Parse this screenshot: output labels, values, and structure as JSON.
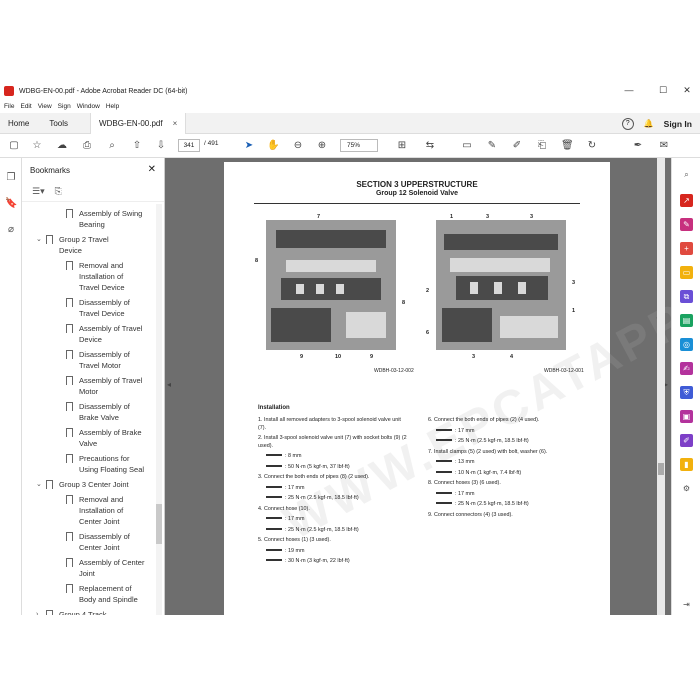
{
  "window": {
    "title": "WDBG-EN-00.pdf - Adobe Acrobat Reader DC (64-bit)",
    "minimize": "—",
    "maximize": "☐",
    "close": "✕"
  },
  "menu": [
    "File",
    "Edit",
    "View",
    "Sign",
    "Window",
    "Help"
  ],
  "tabs": {
    "home": "Home",
    "tools": "Tools",
    "document": "WDBG-EN-00.pdf",
    "close": "×"
  },
  "header_right": {
    "help": "?",
    "bell": "🔔",
    "sign_in": "Sign In"
  },
  "toolbar": {
    "page_current": "341",
    "page_separator": "/",
    "page_total": "491",
    "zoom": "75%"
  },
  "bookmarks": {
    "title": "Bookmarks",
    "items": [
      {
        "text": "Assembly of Swing",
        "indent": 2
      },
      {
        "text": "Bearing",
        "indent": 2,
        "cont": true
      },
      {
        "text": "Group 2 Travel",
        "indent": 1,
        "expander": "⌄"
      },
      {
        "text": "Device",
        "indent": 1,
        "cont": true
      },
      {
        "text": "Removal and",
        "indent": 2
      },
      {
        "text": "Installation of",
        "indent": 2,
        "cont": true
      },
      {
        "text": "Travel Device",
        "indent": 2,
        "cont": true
      },
      {
        "text": "Disassembly of",
        "indent": 2
      },
      {
        "text": "Travel Device",
        "indent": 2,
        "cont": true
      },
      {
        "text": "Assembly of Travel",
        "indent": 2
      },
      {
        "text": "Device",
        "indent": 2,
        "cont": true
      },
      {
        "text": "Disassembly of",
        "indent": 2
      },
      {
        "text": "Travel Motor",
        "indent": 2,
        "cont": true
      },
      {
        "text": "Assembly of Travel",
        "indent": 2
      },
      {
        "text": "Motor",
        "indent": 2,
        "cont": true
      },
      {
        "text": "Disassembly of",
        "indent": 2
      },
      {
        "text": "Brake Valve",
        "indent": 2,
        "cont": true
      },
      {
        "text": "Assembly of Brake",
        "indent": 2
      },
      {
        "text": "Valve",
        "indent": 2,
        "cont": true
      },
      {
        "text": "Precautions for",
        "indent": 2
      },
      {
        "text": "Using Floating Seal",
        "indent": 2,
        "cont": true
      },
      {
        "text": "Group 3 Center Joint",
        "indent": 1,
        "expander": "⌄"
      },
      {
        "text": "Removal and",
        "indent": 2
      },
      {
        "text": "Installation of",
        "indent": 2,
        "cont": true
      },
      {
        "text": "Center Joint",
        "indent": 2,
        "cont": true
      },
      {
        "text": "Disassembly of",
        "indent": 2
      },
      {
        "text": "Center Joint",
        "indent": 2,
        "cont": true
      },
      {
        "text": "Assembly of Center",
        "indent": 2
      },
      {
        "text": "Joint",
        "indent": 2,
        "cont": true
      },
      {
        "text": "Replacement of",
        "indent": 2
      },
      {
        "text": "Body and Spindle",
        "indent": 2,
        "cont": true
      },
      {
        "text": "Group 4 Track",
        "indent": 1,
        "expander": "›"
      }
    ]
  },
  "document": {
    "section_title": "SECTION 3 UPPERSTRUCTURE",
    "section_subtitle": "Group 12 Solenoid Valve",
    "figure1_caption": "WDBH-03-12-002",
    "figure2_caption": "WDBH-03-12-001",
    "figure1_callouts": [
      "7",
      "8",
      "8",
      "9",
      "10",
      "9"
    ],
    "figure2_callouts": [
      "1",
      "3",
      "3",
      "2",
      "3",
      "1",
      "6",
      "3",
      "4"
    ],
    "watermark": "WWW.EPCATAPP.COM",
    "installation_heading": "Installation",
    "left_steps": [
      {
        "text": "1.  Install all removed adapters to 3-spool solenoid valve unit (7).",
        "tools": []
      },
      {
        "text": "2.  Install 3-spool solenoid valve unit (7) with socket bolts (9) (2 used).",
        "tools": [
          ": 8 mm",
          ": 50 N·m (5 kgf·m, 37 lbf·ft)"
        ]
      },
      {
        "text": "3.  Connect the both ends of pipes (8) (2 used).",
        "tools": [
          ": 17 mm",
          ": 25 N·m (2.5 kgf·m, 18.5 lbf·ft)"
        ]
      },
      {
        "text": "4.  Connect hose (10).",
        "tools": [
          ": 17 mm",
          ": 25 N·m (2.5 kgf·m, 18.5 lbf·ft)"
        ]
      },
      {
        "text": "5.  Connect hoses (1) (3 used).",
        "tools": [
          ": 19 mm",
          ": 30 N·m (3 kgf·m, 22 lbf·ft)"
        ]
      }
    ],
    "right_steps": [
      {
        "text": "6.  Connect the both ends of pipes (2) (4 used).",
        "tools": [
          ": 17 mm",
          ": 25 N·m (2.5 kgf·m, 18.5 lbf·ft)"
        ]
      },
      {
        "text": "7.  Install clamps (5) (2 used) with bolt, washer (6).",
        "tools": [
          ": 13 mm",
          ": 10 N·m (1 kgf·m, 7.4 lbf·ft)"
        ]
      },
      {
        "text": "8.  Connect hoses (3) (6 used).",
        "tools": [
          ": 17 mm",
          ": 25 N·m (2.5 kgf·m, 18.5 lbf·ft)"
        ]
      },
      {
        "text": "9.  Connect connectors (4) (3 used).",
        "tools": []
      }
    ]
  },
  "colors": {
    "acrobat_red": "#d7261e",
    "viewer_gray": "#6e6e6e"
  }
}
